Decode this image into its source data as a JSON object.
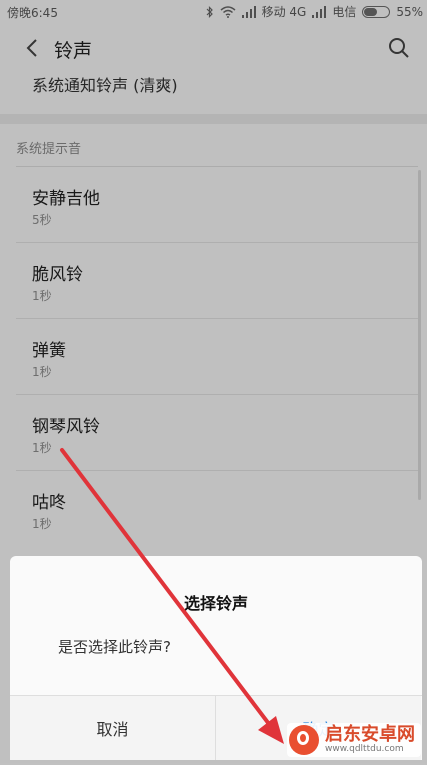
{
  "status_bar": {
    "time": "傍晚6:45",
    "carrier1": "移动 4G",
    "carrier2": "电信",
    "battery_percent": "55%",
    "battery_level": 55
  },
  "header": {
    "title": "铃声"
  },
  "current": {
    "label": "系统通知铃声 (清爽)"
  },
  "section": {
    "header": "系统提示音"
  },
  "list": {
    "items": [
      {
        "title": "安静吉他",
        "duration": "5秒"
      },
      {
        "title": "脆风铃",
        "duration": "1秒"
      },
      {
        "title": "弹簧",
        "duration": "1秒"
      },
      {
        "title": "钢琴风铃",
        "duration": "1秒"
      },
      {
        "title": "咕咚",
        "duration": "1秒"
      }
    ]
  },
  "dialog": {
    "title": "选择铃声",
    "message": "是否选择此铃声?",
    "cancel_label": "取消",
    "ok_label": "确定"
  },
  "watermark": {
    "brand": "启东安卓网",
    "url": "www.qdlttdu.com"
  },
  "colors": {
    "accent": "#2f8be0",
    "annotation_arrow": "#e0343a"
  }
}
